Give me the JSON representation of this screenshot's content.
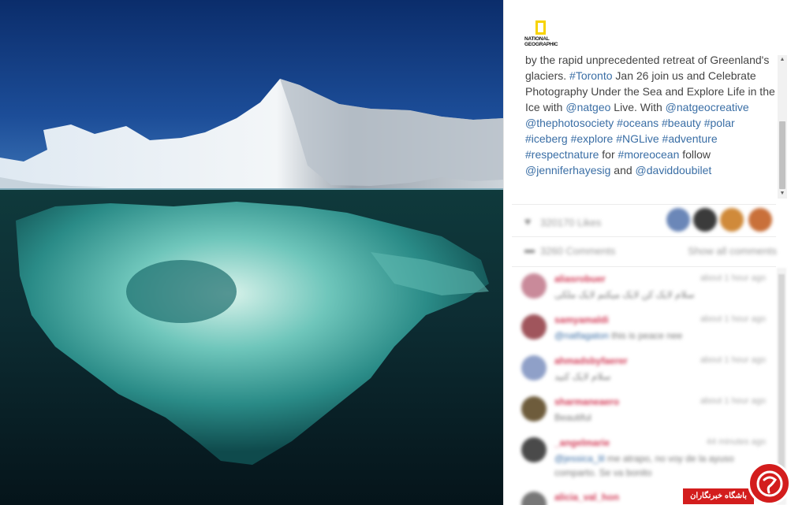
{
  "photo": {
    "alt": ""
  },
  "post": {
    "logo_lines": [
      "NATIONAL",
      "GEOGRAPHIC"
    ],
    "caption": [
      {
        "t": "by the rapid unprecedented retreat of Greenland's glaciers. "
      },
      {
        "t": "#Toronto",
        "link": true
      },
      {
        "t": " Jan 26 join us and Celebrate Photography Under the Sea and Explore Life in the Ice with "
      },
      {
        "t": "@natgeo",
        "link": true
      },
      {
        "t": " Live. With "
      },
      {
        "t": "@natgeocreative",
        "link": true
      },
      {
        "t": " "
      },
      {
        "t": "@thephotosociety",
        "link": true
      },
      {
        "t": " "
      },
      {
        "t": "#oceans",
        "link": true
      },
      {
        "t": " "
      },
      {
        "t": "#beauty",
        "link": true
      },
      {
        "t": " "
      },
      {
        "t": "#polar",
        "link": true
      },
      {
        "t": " "
      },
      {
        "t": "#iceberg",
        "link": true
      },
      {
        "t": " "
      },
      {
        "t": "#explore",
        "link": true
      },
      {
        "t": " "
      },
      {
        "t": "#NGLive",
        "link": true
      },
      {
        "t": " "
      },
      {
        "t": "#adventure",
        "link": true
      },
      {
        "t": " "
      },
      {
        "t": "#respectnature",
        "link": true
      },
      {
        "t": " for "
      },
      {
        "t": "#moreocean",
        "link": true
      },
      {
        "t": " follow "
      },
      {
        "t": "@jenniferhayesig",
        "link": true
      },
      {
        "t": " and "
      },
      {
        "t": "@daviddoubilet",
        "link": true
      }
    ]
  },
  "likes": {
    "icon": "heart-icon",
    "text": "320170 Likes",
    "avatar_colors": [
      "#6b87b8",
      "#3b3b3b",
      "#d08a3a",
      "#c9703a"
    ]
  },
  "comments_header": {
    "icon": "comment-icon",
    "count_text": "3260 Comments",
    "show_all": "Show all comments"
  },
  "comments": [
    {
      "user": "aliasrobuer",
      "time": "about 1 hour ago",
      "text": "سلام لایک کن لایک میکنم لایک ملکی",
      "avatar": "#c98a9a"
    },
    {
      "user": "samyamaldi",
      "time": "about 1 hour ago",
      "mention": "@natfagaton",
      "text": " this is peace nee",
      "avatar": "#a0555c"
    },
    {
      "user": "ahmadsbyfaerer",
      "time": "about 1 hour ago",
      "text": "سلام لایک کنید",
      "avatar": "#8fa0c8"
    },
    {
      "user": "sharmaneaero",
      "time": "about 1 hour ago",
      "text": "Beautiful",
      "avatar": "#6e5c3c"
    },
    {
      "user": "_angelmarie",
      "time": "44 minutes ago",
      "mention": "@jessica_lil",
      "text": " me atrapo, no voy de la ayuso comparto. Se va bonito",
      "avatar": "#4a4a4a"
    },
    {
      "user": "alicia_val_hon",
      "time": "about 1 hour ago",
      "text": "",
      "avatar": "#777"
    }
  ],
  "watermark": {
    "text": "باشگاه خبرنگاران"
  }
}
